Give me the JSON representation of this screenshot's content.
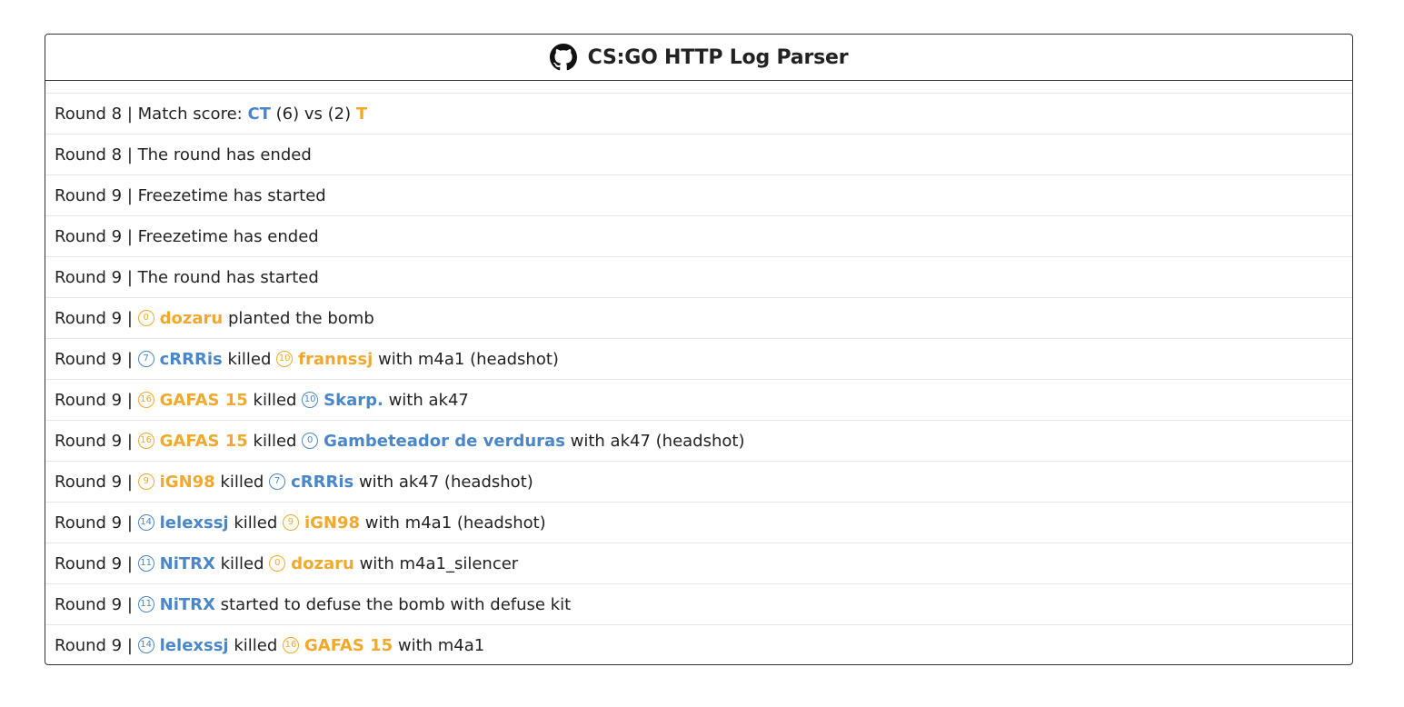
{
  "header": {
    "title": "CS:GO HTTP Log Parser",
    "icon": "github-icon"
  },
  "colors": {
    "ct": "#4a87c8",
    "t": "#f0a92e",
    "text": "#222222",
    "border": "#333333",
    "row_divider": "#e6e6e6"
  },
  "log": [
    [
      {
        "text": "Round 8 | Match score: "
      },
      {
        "text": "CT",
        "team": "ct"
      },
      {
        "text": " (6) vs (2) "
      },
      {
        "text": "T",
        "team": "t"
      }
    ],
    [
      {
        "text": "Round 8 | The round has ended"
      }
    ],
    [
      {
        "text": "Round 9 | Freezetime has started"
      }
    ],
    [
      {
        "text": "Round 9 | Freezetime has ended"
      }
    ],
    [
      {
        "text": "Round 9 | The round has started"
      }
    ],
    [
      {
        "text": "Round 9 | "
      },
      {
        "player": "dozaru",
        "slot": "0",
        "team": "t"
      },
      {
        "text": " planted the bomb"
      }
    ],
    [
      {
        "text": "Round 9 | "
      },
      {
        "player": "cRRRis",
        "slot": "7",
        "team": "ct"
      },
      {
        "text": " killed "
      },
      {
        "player": "frannssj",
        "slot": "10",
        "team": "t"
      },
      {
        "text": " with m4a1 (headshot)"
      }
    ],
    [
      {
        "text": "Round 9 | "
      },
      {
        "player": "GAFAS 15",
        "slot": "16",
        "team": "t"
      },
      {
        "text": " killed "
      },
      {
        "player": "Skarp.",
        "slot": "10",
        "team": "ct"
      },
      {
        "text": " with ak47"
      }
    ],
    [
      {
        "text": "Round 9 | "
      },
      {
        "player": "GAFAS 15",
        "slot": "16",
        "team": "t"
      },
      {
        "text": " killed "
      },
      {
        "player": "Gambeteador de verduras",
        "slot": "0",
        "team": "ct"
      },
      {
        "text": " with ak47 (headshot)"
      }
    ],
    [
      {
        "text": "Round 9 | "
      },
      {
        "player": "iGN98",
        "slot": "9",
        "team": "t"
      },
      {
        "text": " killed "
      },
      {
        "player": "cRRRis",
        "slot": "7",
        "team": "ct"
      },
      {
        "text": " with ak47 (headshot)"
      }
    ],
    [
      {
        "text": "Round 9 | "
      },
      {
        "player": "lelexssj",
        "slot": "14",
        "team": "ct"
      },
      {
        "text": " killed "
      },
      {
        "player": "iGN98",
        "slot": "9",
        "team": "t"
      },
      {
        "text": " with m4a1 (headshot)"
      }
    ],
    [
      {
        "text": "Round 9 | "
      },
      {
        "player": "NiTRX",
        "slot": "11",
        "team": "ct"
      },
      {
        "text": " killed "
      },
      {
        "player": "dozaru",
        "slot": "0",
        "team": "t"
      },
      {
        "text": " with m4a1_silencer"
      }
    ],
    [
      {
        "text": "Round 9 | "
      },
      {
        "player": "NiTRX",
        "slot": "11",
        "team": "ct"
      },
      {
        "text": " started to defuse the bomb with defuse kit"
      }
    ],
    [
      {
        "text": "Round 9 | "
      },
      {
        "player": "lelexssj",
        "slot": "14",
        "team": "ct"
      },
      {
        "text": " killed "
      },
      {
        "player": "GAFAS 15",
        "slot": "16",
        "team": "t"
      },
      {
        "text": " with m4a1"
      }
    ]
  ]
}
